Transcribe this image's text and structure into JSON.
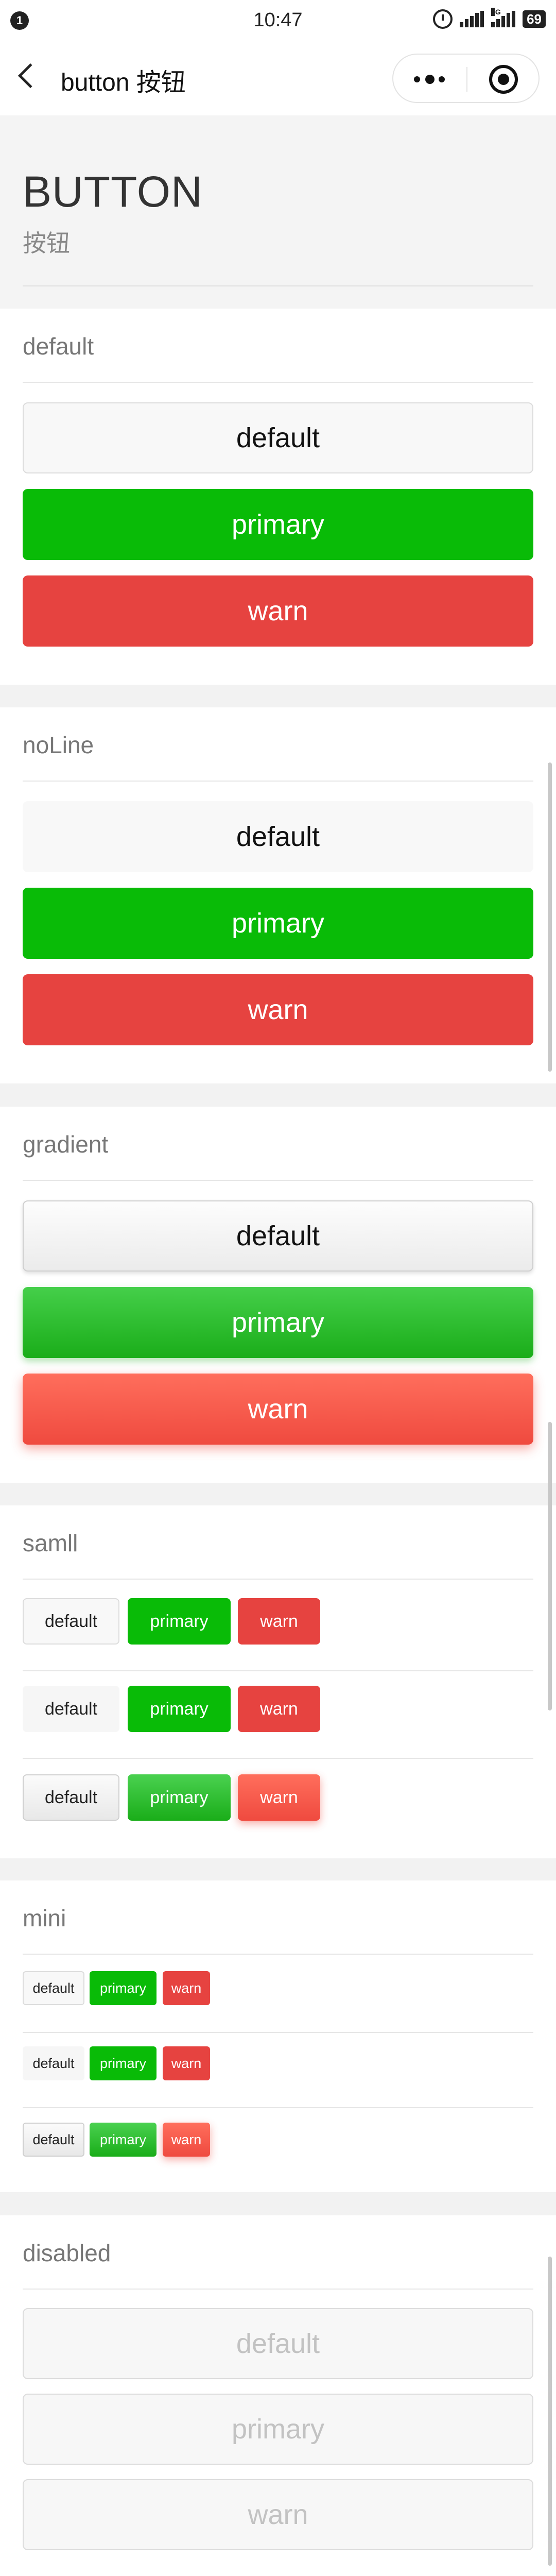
{
  "status_bar": {
    "notification_count": "1",
    "time": "10:47",
    "network_label": "4G",
    "battery": "69",
    "icons": [
      "alarm-clock-icon",
      "signal-icon",
      "signal-4g-icon"
    ]
  },
  "nav": {
    "back_icon": "chevron-left-icon",
    "title": "button 按钮",
    "menu_icon": "more-dots-icon",
    "close_icon": "target-circle-icon"
  },
  "header": {
    "title": "BUTTON",
    "subtitle": "按钮"
  },
  "sections": {
    "default": {
      "title": "default",
      "buttons": {
        "default": "default",
        "primary": "primary",
        "warn": "warn"
      }
    },
    "noline": {
      "title": "noLine",
      "buttons": {
        "default": "default",
        "primary": "primary",
        "warn": "warn"
      }
    },
    "gradient": {
      "title": "gradient",
      "buttons": {
        "default": "default",
        "primary": "primary",
        "warn": "warn"
      }
    },
    "small": {
      "title": "samll",
      "rows": [
        {
          "default": "default",
          "primary": "primary",
          "warn": "warn"
        },
        {
          "default": "default",
          "primary": "primary",
          "warn": "warn"
        },
        {
          "default": "default",
          "primary": "primary",
          "warn": "warn"
        }
      ]
    },
    "mini": {
      "title": "mini",
      "rows": [
        {
          "default": "default",
          "primary": "primary",
          "warn": "warn"
        },
        {
          "default": "default",
          "primary": "primary",
          "warn": "warn"
        },
        {
          "default": "default",
          "primary": "primary",
          "warn": "warn"
        }
      ]
    },
    "disabled": {
      "title": "disabled",
      "buttons": {
        "default": "default",
        "primary": "primary",
        "warn": "warn"
      }
    }
  },
  "colors": {
    "primary": "#09bb07",
    "warn": "#e64340",
    "default_bg": "#f8f8f8",
    "disabled_text": "#c2c2c2",
    "page_bg": "#f2f2f2"
  }
}
